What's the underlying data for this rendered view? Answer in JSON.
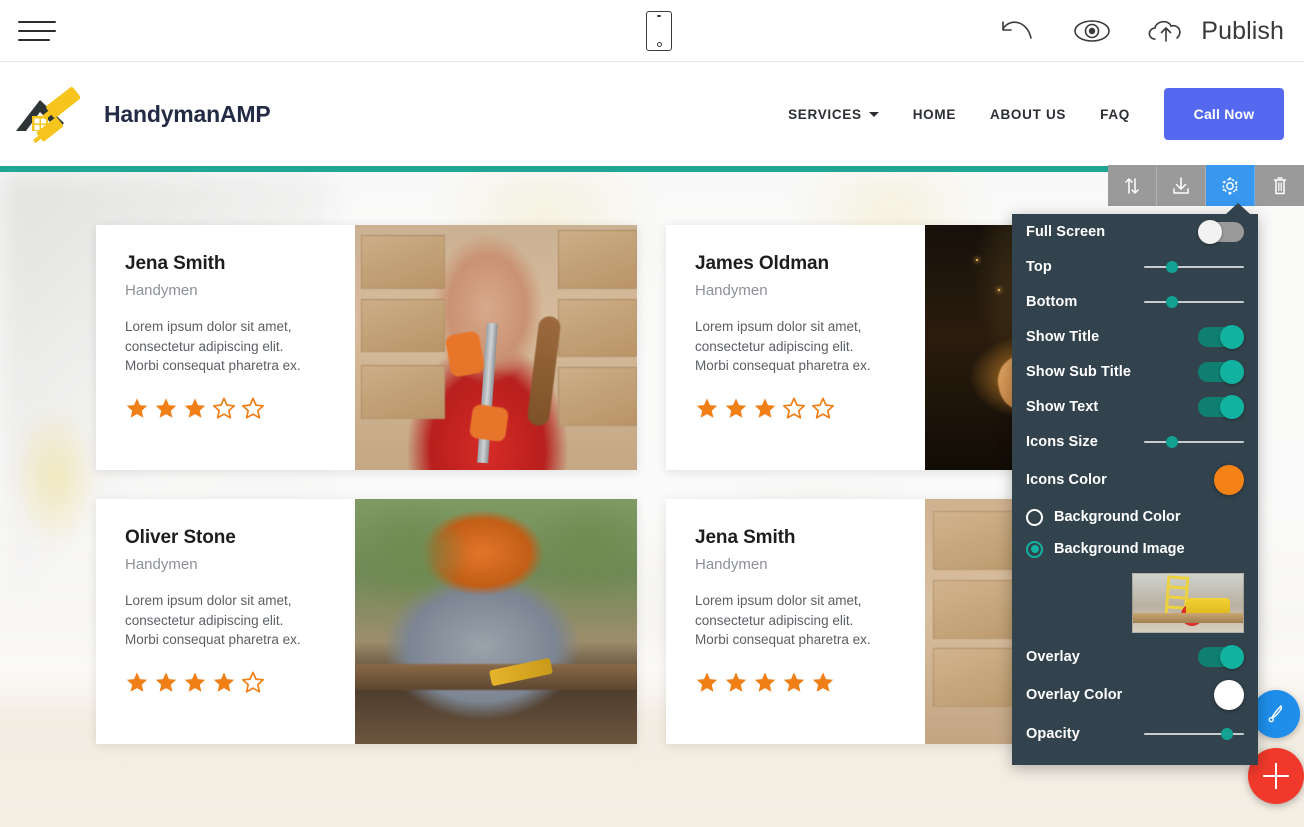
{
  "editor_bar": {
    "menu_icon": "hamburger-menu-icon",
    "device_icon": "mobile-device-icon",
    "undo_icon": "undo-arrow-icon",
    "preview_icon": "eye-preview-icon",
    "publish_icon": "cloud-upload-icon",
    "publish_label": "Publish"
  },
  "site_header": {
    "logo_icon": "house-paint-roller-logo-icon",
    "brand_name": "HandymanAMP",
    "nav": [
      {
        "label": "SERVICES",
        "has_caret": true
      },
      {
        "label": "HOME",
        "has_caret": false
      },
      {
        "label": "ABOUT US",
        "has_caret": false
      },
      {
        "label": "FAQ",
        "has_caret": false
      }
    ],
    "cta_label": "Call Now",
    "cta_color": "#5469f0"
  },
  "accent_strip_color": "#21a595",
  "element_toolbar": {
    "buttons": [
      {
        "name": "move-section",
        "icon": "up-down-arrows-icon",
        "active": false
      },
      {
        "name": "save-section",
        "icon": "download-icon",
        "active": false
      },
      {
        "name": "section-settings",
        "icon": "gear-icon",
        "active": true
      },
      {
        "name": "delete-section",
        "icon": "trash-icon",
        "active": false
      }
    ],
    "active_color": "#3897ef",
    "inactive_color": "#9a9a9a"
  },
  "cards": [
    {
      "title": "Jena Smith",
      "subtitle": "Handymen",
      "text": "Lorem ipsum dolor sit amet, consectetur adipiscing elit. Morbi consequat pharetra ex.",
      "rating": 3,
      "max_rating": 5,
      "photo": "woman-in-red-jacket-with-orange-gloves"
    },
    {
      "title": "James Oldman",
      "subtitle": "Handymen",
      "text": "Lorem ipsum dolor sit amet, consectetur adipiscing elit. Morbi consequat pharetra ex.",
      "rating": 3,
      "max_rating": 5,
      "photo": "hand-welding-sparks-dark"
    },
    {
      "title": "Oliver Stone",
      "subtitle": "Handymen",
      "text": "Lorem ipsum dolor sit amet, consectetur adipiscing elit. Morbi consequat pharetra ex.",
      "rating": 4,
      "max_rating": 5,
      "photo": "worker-with-orange-helmet-outdoors"
    },
    {
      "title": "Jena Smith",
      "subtitle": "Handymen",
      "text": "Lorem ipsum dolor sit amet, consectetur adipiscing elit. Morbi consequat pharetra ex.",
      "rating": 5,
      "max_rating": 5,
      "photo": "warehouse-boxes-with-worker"
    }
  ],
  "star_color": "#f07f18",
  "settings_panel": {
    "background_color": "#32434d",
    "rows": [
      {
        "label": "Full Screen",
        "control": "toggle",
        "value": false
      },
      {
        "label": "Top",
        "control": "slider",
        "value": 25
      },
      {
        "label": "Bottom",
        "control": "slider",
        "value": 25
      },
      {
        "label": "Show Title",
        "control": "toggle",
        "value": true
      },
      {
        "label": "Show Sub Title",
        "control": "toggle",
        "value": true
      },
      {
        "label": "Show Text",
        "control": "toggle",
        "value": true
      },
      {
        "label": "Icons Size",
        "control": "slider",
        "value": 25
      },
      {
        "label": "Icons Color",
        "control": "swatch",
        "value": "#f58216"
      }
    ],
    "background_options": [
      {
        "label": "Background Color",
        "selected": false
      },
      {
        "label": "Background Image",
        "selected": true
      }
    ],
    "thumbnail": "circular-saw-on-workbench",
    "rows_after": [
      {
        "label": "Overlay",
        "control": "toggle",
        "value": true
      },
      {
        "label": "Overlay Color",
        "control": "swatch",
        "value": "#ffffff"
      },
      {
        "label": "Opacity",
        "control": "slider",
        "value": 87
      }
    ],
    "toggle_on_color": "#12b2a0",
    "toggle_off_color": "#9a9a9a",
    "slider_knob_color": "#12a192"
  },
  "floating_buttons": [
    {
      "name": "design-button",
      "icon": "pen-brush-icon",
      "color": "#1e8eea"
    },
    {
      "name": "add-block-button",
      "icon": "plus-icon",
      "color": "#f0392b"
    }
  ]
}
